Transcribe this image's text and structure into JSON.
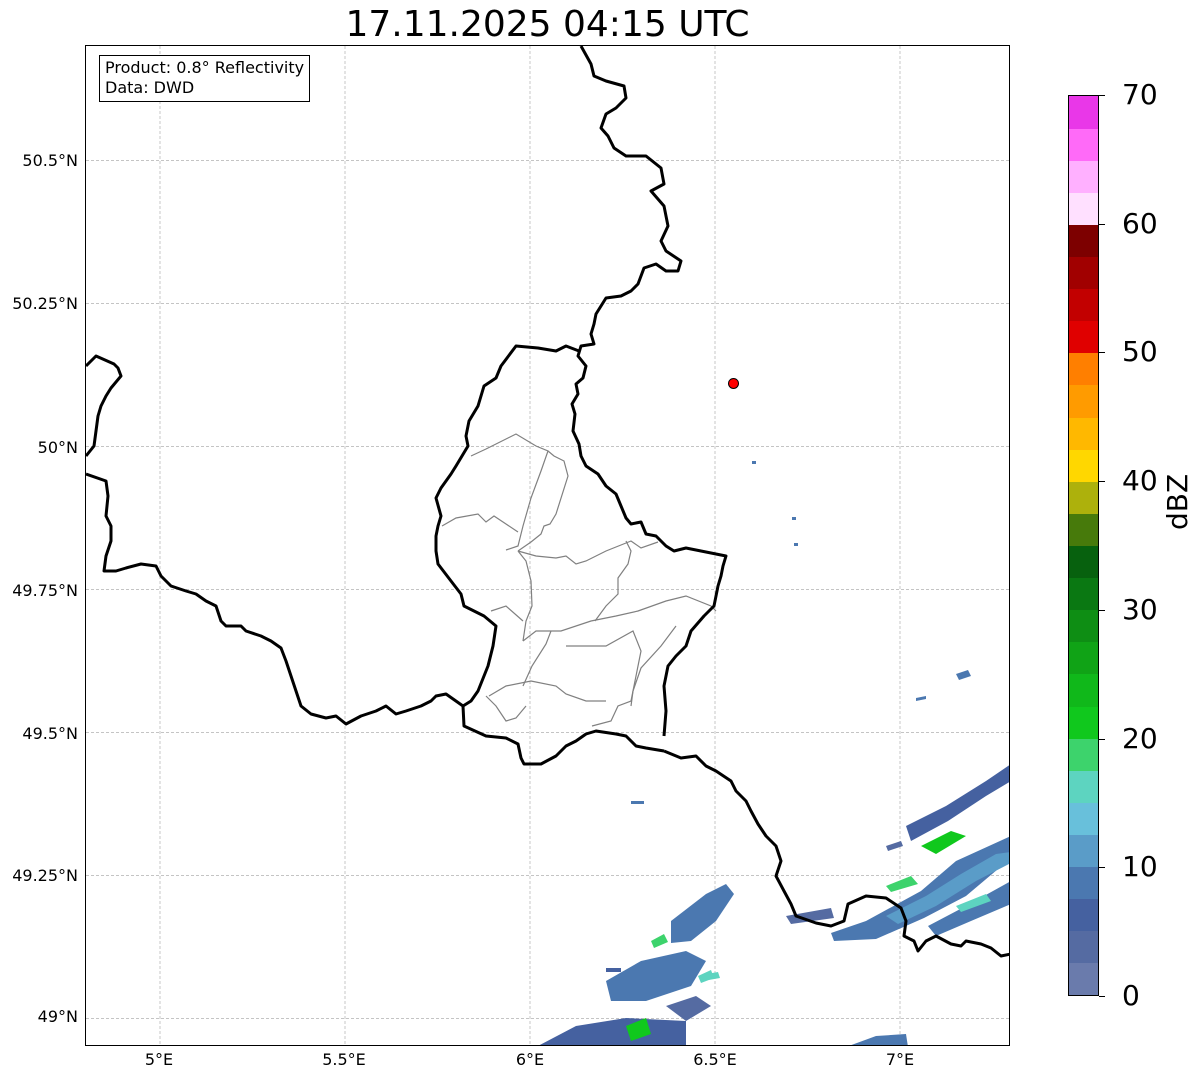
{
  "title": "17.11.2025 04:15 UTC",
  "info": {
    "product": "Product: 0.8° Reflectivity",
    "source": "Data: DWD"
  },
  "axes": {
    "lat_labels": [
      "50.5°N",
      "50.25°N",
      "50°N",
      "49.75°N",
      "49.5°N",
      "49.25°N",
      "49°N"
    ],
    "lon_labels": [
      "5°E",
      "5.5°E",
      "6°E",
      "6.5°E",
      "7°E"
    ]
  },
  "extent": {
    "lon_min": 4.8,
    "lon_max": 7.3,
    "lat_min": 48.95,
    "lat_max": 50.7
  },
  "marker": {
    "name": "radar-site",
    "lon": 6.55,
    "lat": 50.11,
    "color": "#ff0000"
  },
  "colorbar": {
    "label": "dBZ",
    "tick_labels": [
      "0",
      "10",
      "20",
      "30",
      "40",
      "50",
      "60",
      "70"
    ],
    "min": 0,
    "max": 70,
    "step": 2.5,
    "colors": [
      "#6a7bac",
      "#556ba2",
      "#4561a0",
      "#4b78b0",
      "#5a9cc8",
      "#68c0db",
      "#5dd4c0",
      "#3dd36c",
      "#10c81d",
      "#10b81a",
      "#10a316",
      "#0e8e14",
      "#0a7812",
      "#07610e",
      "#477a0b",
      "#adb10c",
      "#ffd700",
      "#ffb800",
      "#ff9b00",
      "#ff7f00",
      "#e00000",
      "#c20000",
      "#a10000",
      "#7d0000",
      "#ffe0ff",
      "#ffb0ff",
      "#ff6af8",
      "#e937e8"
    ]
  },
  "colors": {
    "national_border": "#000000",
    "canton_border": "#808080",
    "grid": "#b0b0b0"
  }
}
